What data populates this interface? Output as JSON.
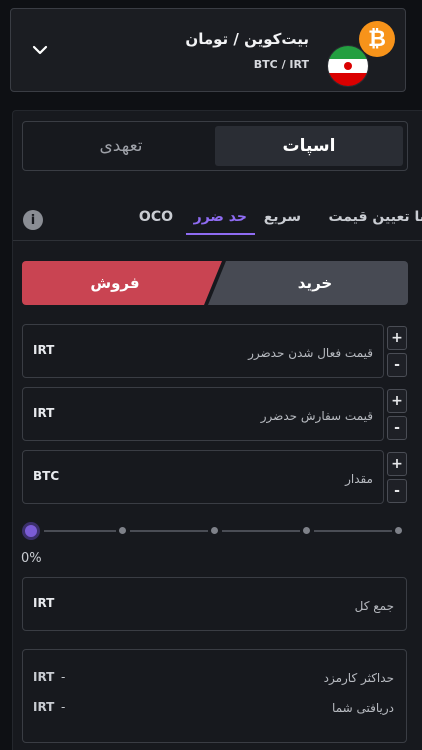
{
  "market": {
    "title": "بیت‌کوین / تومان",
    "pair": "BTC / IRT",
    "coin_icon": "bitcoin-icon",
    "flag_icon": "iran-flag-icon",
    "chevron_icon": "chevron-down-icon"
  },
  "mode_tabs": {
    "active": "اسپات",
    "inactive": "تعهدی"
  },
  "order_tabs": {
    "items": [
      "با تعیین قیمت",
      "سریع",
      "حد ضرر",
      "OCO"
    ],
    "active_index": 2,
    "info_icon": "info-icon"
  },
  "side": {
    "buy": "خرید",
    "sell": "فروش",
    "active": "sell"
  },
  "fields": [
    {
      "label": "قیمت فعال شدن حدضرر",
      "currency": "IRT"
    },
    {
      "label": "قیمت سفارش حدضرر",
      "currency": "IRT"
    },
    {
      "label": "مقدار",
      "currency": "BTC"
    }
  ],
  "stepper": {
    "plus": "+",
    "minus": "-"
  },
  "slider": {
    "percent_label": "0%",
    "value": 0
  },
  "total": {
    "label": "جمع کل",
    "currency": "IRT"
  },
  "summary": {
    "max_fee_label": "حداکثر کارمزد",
    "max_fee_currency": "IRT",
    "max_fee_value": "-",
    "receive_label": "دریافتی شما",
    "receive_currency": "IRT",
    "receive_value": "-"
  },
  "colors": {
    "accent": "#8f6cf3",
    "sell": "#c94452",
    "buy_inactive": "#474a53",
    "bitcoin": "#f7931a"
  }
}
